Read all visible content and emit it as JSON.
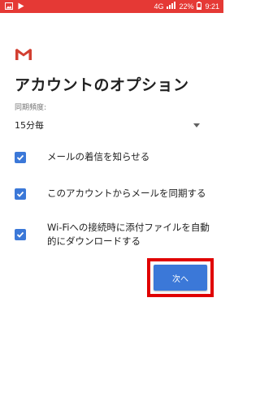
{
  "status_bar": {
    "network": "4G",
    "battery": "22%",
    "time": "9:21"
  },
  "colors": {
    "status_bar": "#e53935",
    "accent": "#3b78d8",
    "highlight": "#e00000"
  },
  "app": {
    "logo": "gmail-logo-icon"
  },
  "page_title": "アカウントのオプション",
  "sync_frequency": {
    "label": "同期頻度:",
    "value": "15分毎"
  },
  "options": [
    {
      "label": "メールの着信を知らせる",
      "checked": true
    },
    {
      "label": "このアカウントからメールを同期する",
      "checked": true
    },
    {
      "label": "Wi-Fiへの接続時に添付ファイルを自動的にダウンロードする",
      "checked": true
    }
  ],
  "next_button": {
    "label": "次へ"
  }
}
